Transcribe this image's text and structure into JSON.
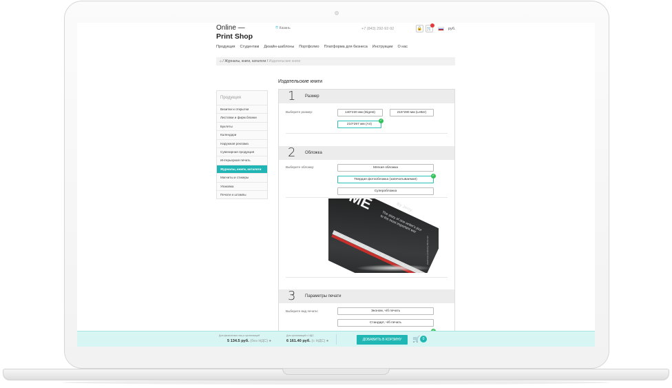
{
  "header": {
    "logo_line1": "Online —",
    "logo_line2": "Print Shop",
    "city": "Казань",
    "phone": "+7 (843) 292-92-92",
    "currency": "руб."
  },
  "nav": [
    "Продукция",
    "Студентам",
    "Дизайн-шаблоны",
    "Портфолио",
    "Платформа для бизнеса",
    "Инструкции",
    "О нас"
  ],
  "breadcrumbs": {
    "home_icon": "home-icon",
    "item1": "Журналы, книги, каталоги",
    "current": "Издательские книги"
  },
  "sidebar": {
    "title": "Продукция",
    "items": [
      {
        "label": "Визитки и открытки"
      },
      {
        "label": "Листовки и фирм.бланки"
      },
      {
        "label": "Буклеты"
      },
      {
        "label": "Календари"
      },
      {
        "label": "Наружная реклама"
      },
      {
        "label": "Сувенирная продукция"
      },
      {
        "label": "Интерьерная печать"
      },
      {
        "label": "Журналы, книги, каталоги",
        "active": true
      },
      {
        "label": "Магниты и стикеры"
      },
      {
        "label": "Упаковка"
      },
      {
        "label": "Печати и штампы"
      }
    ]
  },
  "page_title": "Издательские книги",
  "sections": {
    "size": {
      "num": "1",
      "title": "Размер",
      "label": "Выберите размер:",
      "options": [
        "140*220 мм (Digest)",
        "215*280 мм (Letter)",
        "210*297 мм (A4)"
      ],
      "selected": "210*297 мм (A4)"
    },
    "cover": {
      "num": "2",
      "title": "Обложка",
      "label": "Выберите обложку:",
      "options": [
        "Мягкая обложка",
        "Твердая фотообложка (запечатываемая)",
        "Суперобложка"
      ],
      "selected": "Твердая фотообложка (запечатываемая)",
      "photo_text": {
        "big": "ME",
        "by": "By Jerry",
        "story_line1": "The story of one writer's jour",
        "story_line2": "to the most important wor",
        "side": "Hardcover printed by Blurb.com"
      }
    },
    "print": {
      "num": "3",
      "title": "Параметры печати",
      "label": "Выберите вид печати:",
      "options": [
        "Эконом, ч/б печать",
        "Стандарт, ч/б печать"
      ]
    }
  },
  "bottom_bar": {
    "individuals_label": "Для физических лиц и организаций",
    "individuals_price": "5 134.5 руб.",
    "individuals_note": "(без НДС)",
    "org_label": "Для организаций с НДС",
    "org_price": "6 161.40 руб.",
    "org_note": "(с НДС)",
    "add_to_cart": "ДОБАВИТЬ В КОРЗИНУ",
    "cart_count": "0"
  },
  "colors": {
    "accent": "#20b6b3",
    "check": "#35c15b",
    "bar_bg": "#d6f5f3"
  }
}
